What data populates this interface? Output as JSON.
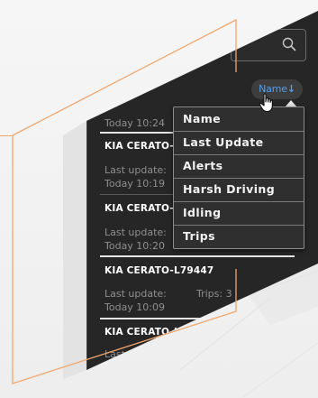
{
  "search": {
    "icon": "search-icon"
  },
  "sort": {
    "label": "Name",
    "arrow": "↓"
  },
  "dropdown": {
    "items": [
      "Name",
      "Last Update",
      "Alerts",
      "Harsh Driving",
      "Idling",
      "Trips"
    ]
  },
  "list": {
    "partial_top": "Today 10:24",
    "rows": [
      {
        "title": "KIA CERATO-",
        "last_update_label": "Last update:",
        "time": "Today 10:19"
      },
      {
        "title": "KIA CERATO-",
        "last_update_label": "Last update:",
        "time": "Today 10:20"
      },
      {
        "title": "KIA CERATO-L79447",
        "last_update_label": "Last update:",
        "time": "Today 10:09",
        "trips": "Trips: 3"
      },
      {
        "title": "KIA CERATO-L",
        "last_update_label": "Last"
      }
    ]
  },
  "colors": {
    "panel": "#262626",
    "accent_blue": "#4e9ff5",
    "decor_orange": "#f2a66c"
  }
}
